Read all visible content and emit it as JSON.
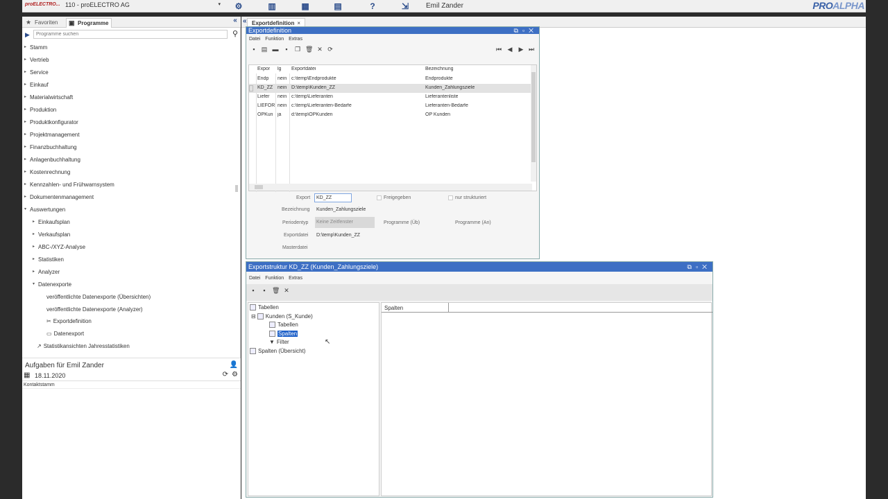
{
  "topbar": {
    "logo_text": "proELECTRO...",
    "company": "110 - proELECTRO AG",
    "icons": [
      "gear-icon",
      "columns-icon",
      "grid-icon",
      "calendar-icon",
      "help-icon",
      "exit-icon"
    ],
    "user": "Emil Zander",
    "brand_main": "PRO",
    "brand_accent": "ALPHA"
  },
  "left_tabs": {
    "favorites": "Favoriten",
    "programs": "Programme"
  },
  "search": {
    "placeholder": "Programme suchen"
  },
  "tree": {
    "items": [
      {
        "label": "Stamm"
      },
      {
        "label": "Vertrieb"
      },
      {
        "label": "Service"
      },
      {
        "label": "Einkauf"
      },
      {
        "label": "Materialwirtschaft"
      },
      {
        "label": "Produktion"
      },
      {
        "label": "Produktkonfigurator"
      },
      {
        "label": "Projektmanagement"
      },
      {
        "label": "Finanzbuchhaltung"
      },
      {
        "label": "Anlagenbuchhaltung"
      },
      {
        "label": "Kostenrechnung"
      },
      {
        "label": "Kennzahlen- und Frühwarnsystem"
      },
      {
        "label": "Dokumentenmanagement"
      },
      {
        "label": "Auswertungen"
      },
      {
        "label": "Einkaufsplan"
      },
      {
        "label": "Verkaufsplan"
      },
      {
        "label": "ABC-/XYZ-Analyse"
      },
      {
        "label": "Statistiken"
      },
      {
        "label": "Analyzer"
      },
      {
        "label": "Datenexporte"
      },
      {
        "label": "veröffentlichte Datenexporte (Übersichten)"
      },
      {
        "label": "veröffentlichte Datenexporte (Analyzer)"
      },
      {
        "label": "Exportdefinition"
      },
      {
        "label": "Datenexport"
      },
      {
        "label": "Statistikansichten Jahresstatistiken"
      }
    ]
  },
  "tasks": {
    "title": "Aufgaben für Emil Zander",
    "date": "18.11.2020",
    "row": "Kontaktstamm"
  },
  "main_tab": {
    "label": "Exportdefinition",
    "close": "×"
  },
  "win1": {
    "title": "Exportdefinition",
    "menu": [
      "Datei",
      "Funktion",
      "Extras"
    ],
    "grid": {
      "headers": [
        "Expor",
        "lg",
        "Exportdatei",
        "Bezeichnung"
      ],
      "rows": [
        {
          "export": "Endp",
          "flag": "nein",
          "file": "c:\\temp\\Endprodukte",
          "desc": "Endprodukte"
        },
        {
          "export": "KD_ZZ",
          "flag": "nein",
          "file": "D:\\temp\\Kunden_ZZ",
          "desc": "Kunden_Zahlungsziele"
        },
        {
          "export": "Liefer",
          "flag": "nein",
          "file": "c:\\temp\\Lieferanten",
          "desc": "Lieferantenliste"
        },
        {
          "export": "LIEFOR",
          "flag": "nein",
          "file": "c:\\temp\\Lieferanten-Bedarfe",
          "desc": "Lieferanten-Bedarfe"
        },
        {
          "export": "OPKun",
          "flag": "ja",
          "file": "d:\\temp\\OPKunden",
          "desc": "OP Kunden"
        }
      ]
    },
    "form": {
      "export_label": "Export",
      "export_value": "KD_ZZ",
      "freigegeben": "Freigegeben",
      "strukturiert": "nur strukturiert",
      "bez_label": "Bezeichnung",
      "bez_value": "Kunden_Zahlungsziele",
      "periode_label": "Periodentyp",
      "periode_value": "Keine Zeitfenster",
      "prog_u": "Programme (Üb)",
      "prog_a": "Programme (An)",
      "datei_label": "Exportdatei",
      "datei_value": "D:\\temp\\Kunden_ZZ",
      "master_label": "Masterdatei"
    }
  },
  "win2": {
    "title": "Exportstruktur KD_ZZ (Kunden_Zahlungsziele)",
    "menu": [
      "Datei",
      "Funktion",
      "Extras"
    ],
    "tree": {
      "tabellen": "Tabellen",
      "kunden": "Kunden (S_Kunde)",
      "sub_tabellen": "Tabellen",
      "spalten": "Spalten",
      "filter": "Filter",
      "spalten_uebersicht": "Spalten (Übersicht)"
    },
    "col_header": "Spalten"
  },
  "colors": {
    "titlebar": "#3d6fc4",
    "selection": "#1c5fc8",
    "icon_blue": "#2a4b8a"
  }
}
